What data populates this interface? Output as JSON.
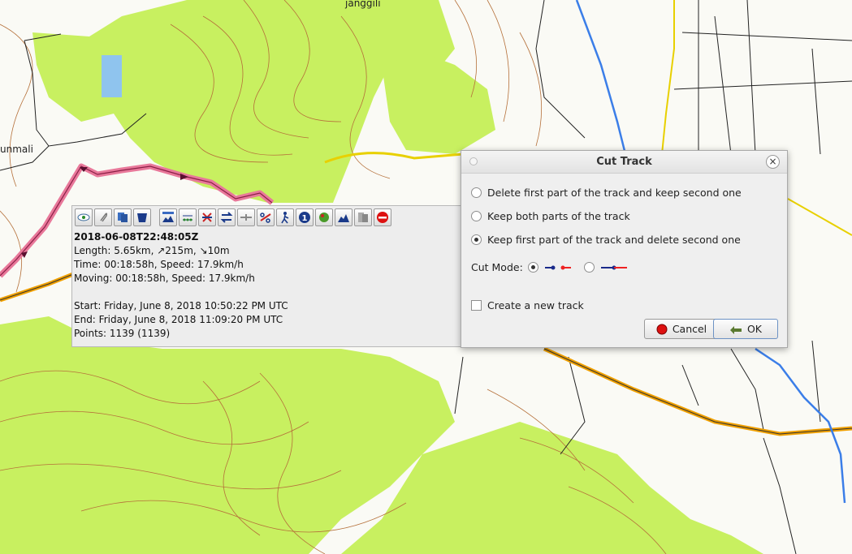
{
  "map": {
    "labels": {
      "top": "janggili",
      "left": "unmali"
    },
    "colors": {
      "forest": "#c8f060",
      "contour": "#b5703a",
      "water": "#3b7ee8",
      "track": "#e8789a",
      "road_major": "#f0a000",
      "road_minor": "#e8d000"
    }
  },
  "popup": {
    "toolbar_icons": [
      "eye-icon",
      "paperclip-icon",
      "copy-icon",
      "delete-basket-icon",
      "elevation-chart-icon",
      "waypoints-icon",
      "reverse-icon",
      "swap-icon",
      "join-icon",
      "cut-icon",
      "hiker-icon",
      "info-icon",
      "color-icon",
      "profile-icon",
      "export-icon",
      "close-track-icon"
    ],
    "title": "2018-06-08T22:48:05Z",
    "length": "Length: 5.65km, ↗215m, ↘10m",
    "time": "Time: 00:18:58h, Speed: 17.9km/h",
    "moving": "Moving: 00:18:58h, Speed: 17.9km/h",
    "start": "Start: Friday, June 8, 2018 10:50:22 PM UTC",
    "end": "End: Friday, June 8, 2018 11:09:20 PM UTC",
    "points": "Points: 1139 (1139)"
  },
  "dialog": {
    "title": "Cut Track",
    "close": "×",
    "options": [
      {
        "label": "Delete first part of the track and keep second one",
        "selected": false
      },
      {
        "label": "Keep both parts of the track",
        "selected": false
      },
      {
        "label": "Keep first part of the track and delete second one",
        "selected": true
      }
    ],
    "cut_mode_label": "Cut Mode:",
    "cut_mode_selected": 0,
    "create_new_track": {
      "label": "Create a new track",
      "checked": false
    },
    "cancel": "Cancel",
    "ok": "OK"
  }
}
